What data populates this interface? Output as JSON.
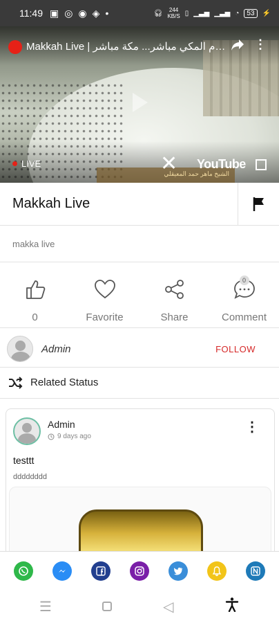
{
  "status_bar": {
    "time": "11:49",
    "network_speed_value": "244",
    "network_speed_unit": "KB/S",
    "battery": "53"
  },
  "video": {
    "title": "Makkah Live | بث مباشر | الحرم المكي مباشر... مكة مباشر",
    "live_label": "LIVE",
    "youtube_label": "YouTube",
    "caption": "الشيخ ماهر حمد المعيقلي"
  },
  "post": {
    "title": "Makkah Live",
    "description": "makka live"
  },
  "actions": [
    {
      "icon": "thumbs-up-icon",
      "label": "0"
    },
    {
      "icon": "heart-icon",
      "label": "Favorite"
    },
    {
      "icon": "share-icon",
      "label": "Share"
    },
    {
      "icon": "comment-icon",
      "label": "Comment",
      "badge": "0"
    }
  ],
  "author": {
    "name": "Admin",
    "follow_label": "FOLLOW"
  },
  "related": {
    "label": "Related Status"
  },
  "card": {
    "author": "Admin",
    "time": "9 days ago",
    "title": "testtt",
    "body": "dddddddd"
  },
  "share_icons": [
    {
      "name": "whatsapp-icon",
      "color": "#2fb84a"
    },
    {
      "name": "messenger-icon",
      "color": "#2a8df5"
    },
    {
      "name": "facebook-icon",
      "color": "#223f8f"
    },
    {
      "name": "instagram-icon",
      "color": "#7a1fa8"
    },
    {
      "name": "twitter-icon",
      "color": "#3a8ed9"
    },
    {
      "name": "notification-icon",
      "color": "#f2c419"
    },
    {
      "name": "other-share-icon",
      "color": "#1e7ab8"
    }
  ],
  "colors": {
    "follow": "#d62828",
    "accent_teal": "#6dbfa4"
  }
}
